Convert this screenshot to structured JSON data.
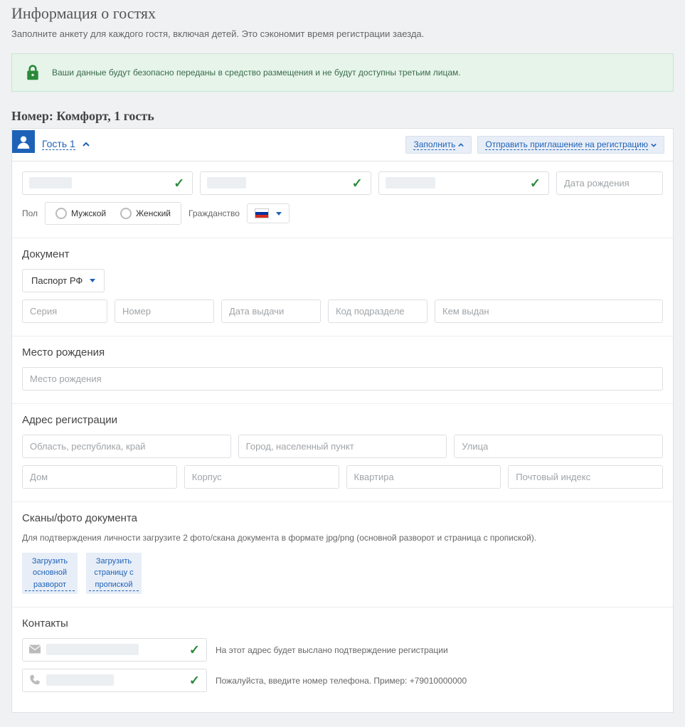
{
  "page": {
    "title": "Информация о гостях",
    "subtitle": "Заполните анкету для каждого гостя, включая детей. Это сэкономит время регистрации заезда."
  },
  "alert": {
    "text": "Ваши данные будут безопасно переданы в средство размещения и не будут доступны третьим лицам."
  },
  "room": {
    "title": "Номер: Комфорт, 1 гость"
  },
  "guest_header": {
    "label": "Гость 1",
    "fill_action": "Заполнить",
    "invite_action": "Отправить приглашение на регистрацию"
  },
  "personal": {
    "dob_placeholder": "Дата рождения",
    "sex_label": "Пол",
    "sex_male": "Мужской",
    "sex_female": "Женский",
    "citizenship_label": "Гражданство"
  },
  "document": {
    "title": "Документ",
    "type_value": "Паспорт РФ",
    "series_ph": "Серия",
    "number_ph": "Номер",
    "issue_date_ph": "Дата выдачи",
    "dept_code_ph": "Код подразделе",
    "issued_by_ph": "Кем выдан"
  },
  "birthplace": {
    "title": "Место рождения",
    "placeholder": "Место рождения"
  },
  "address": {
    "title": "Адрес регистрации",
    "region_ph": "Область, республика, край",
    "city_ph": "Город, населенный пункт",
    "street_ph": "Улица",
    "house_ph": "Дом",
    "building_ph": "Корпус",
    "apt_ph": "Квартира",
    "zip_ph": "Почтовый индекс"
  },
  "scans": {
    "title": "Сканы/фото документа",
    "hint": "Для подтверждения личности загрузите 2 фото/скана документа в формате jpg/png (основной разворот и страница с пропиской).",
    "upload_main": "Загрузить основной разворот",
    "upload_reg": "Загрузить страницу с пропиской"
  },
  "contacts": {
    "title": "Контакты",
    "email_hint": "На этот адрес будет выслано подтверждение регистрации",
    "phone_hint": "Пожалуйста, введите номер телефона. Пример: +79010000000"
  }
}
